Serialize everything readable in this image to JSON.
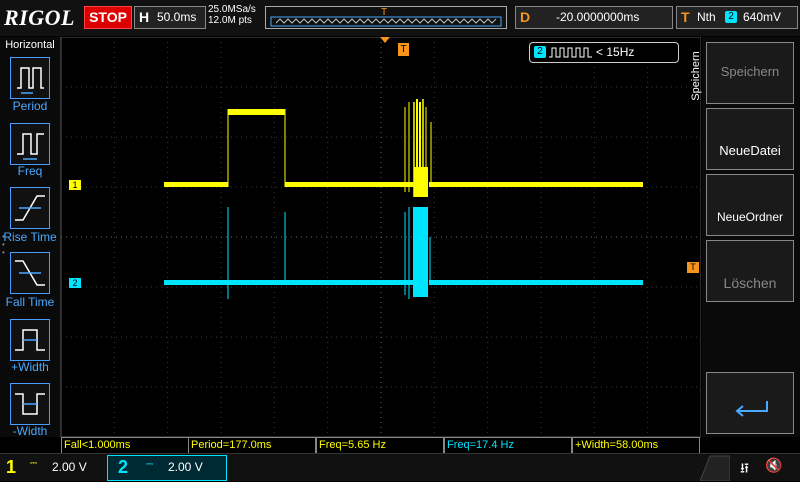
{
  "topbar": {
    "logo": "RIGOL",
    "run_state": "STOP",
    "horizontal_letter": "H",
    "timebase": "50.0ms",
    "sample_rate": "25.0MSa/s",
    "memory_depth": "12.0M pts",
    "trigger_marker": "T",
    "delay_letter": "D",
    "delay_value": "-20.0000000ms",
    "trigger_letter": "T",
    "trigger_type": "Nth",
    "trigger_source": "2",
    "trigger_level": "640mV"
  },
  "left_menu": {
    "title": "Horizontal",
    "items": [
      {
        "label": "Period"
      },
      {
        "label": "Freq"
      },
      {
        "label": "Rise Time"
      },
      {
        "label": "Fall Time"
      },
      {
        "label": "+Width"
      },
      {
        "label": "-Width"
      }
    ]
  },
  "screen": {
    "ch1_marker": "1",
    "ch2_marker": "2",
    "trigger_top_marker": "T",
    "trigger_level_marker": "T",
    "freq_readout": {
      "channel": "2",
      "text": "< 15Hz"
    }
  },
  "right_menu": {
    "title": "Speichern",
    "items": [
      {
        "label": "Speichern",
        "enabled": false
      },
      {
        "label": "NeueDatei",
        "enabled": true
      },
      {
        "label": "NeueOrdner",
        "enabled": true
      },
      {
        "label": "Löschen",
        "enabled": false
      }
    ]
  },
  "measurements": [
    {
      "text": "Fall<1.000ms"
    },
    {
      "text": "Period=177.0ms"
    },
    {
      "text": "Freq=5.65 Hz"
    },
    {
      "text": "Freq=17.4 Hz"
    },
    {
      "text": "+Width=58.00ms"
    }
  ],
  "bottombar": {
    "ch1_num": "1",
    "ch1_scale": "2.00 V",
    "ch2_num": "2",
    "ch2_scale": "2.00 V"
  },
  "colors": {
    "ch1": "#ffff00",
    "ch2": "#00e5ff",
    "trigger": "#f7941d",
    "accent": "#4aa8ff"
  }
}
